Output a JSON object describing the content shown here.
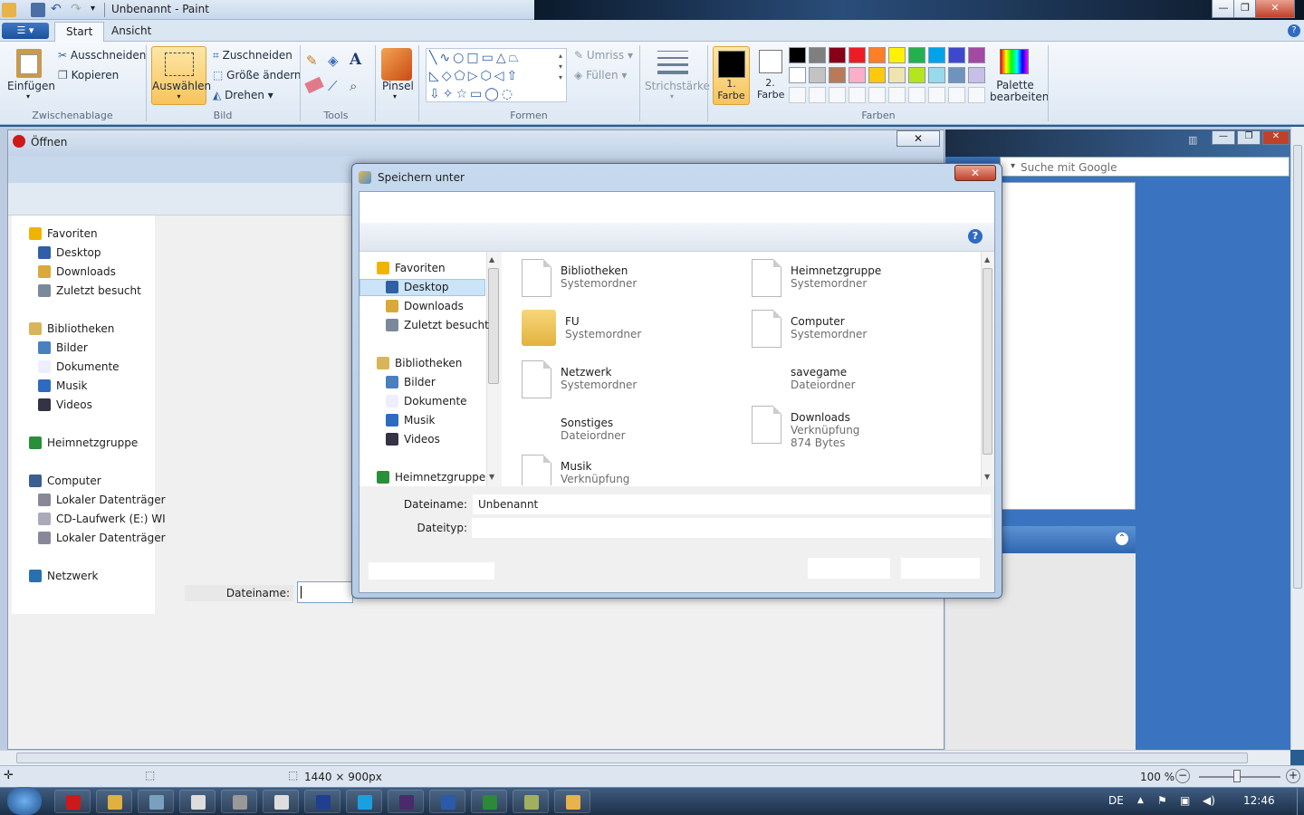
{
  "window": {
    "title": "Unbenannt - Paint"
  },
  "tabs": {
    "menu": "☰ ▾",
    "start": "Start",
    "view": "Ansicht"
  },
  "clipboard": {
    "paste": "Einfügen",
    "cut": "Ausschneiden",
    "copy": "Kopieren",
    "label": "Zwischenablage"
  },
  "image": {
    "select": "Auswählen",
    "crop": "Zuschneiden",
    "resize": "Größe ändern",
    "rotate": "Drehen",
    "label": "Bild"
  },
  "tools": {
    "label": "Tools"
  },
  "brush": {
    "label": "Pinsel"
  },
  "shapes": {
    "outline": "Umriss",
    "fill": "Füllen",
    "label": "Formen"
  },
  "stroke": {
    "label": "Strichstärke"
  },
  "colors": {
    "color1": "1. Farbe",
    "color2": "2. Farbe",
    "edit": "Palette bearbeiten",
    "label": "Farben",
    "palette": [
      "#000000",
      "#7f7f7f",
      "#880015",
      "#ed1c24",
      "#ff7f27",
      "#fff200",
      "#22b14c",
      "#00a2e8",
      "#3f48cc",
      "#a349a4",
      "#ffffff",
      "#c3c3c3",
      "#b97a57",
      "#ffaec9",
      "#ffc90e",
      "#efe4b0",
      "#b5e61d",
      "#99d9ea",
      "#7092be",
      "#c8bfe7"
    ]
  },
  "bg_dialog": {
    "title": "Öffnen",
    "filename_label": "Dateiname:",
    "nav": [
      "Favoriten",
      "Desktop",
      "Downloads",
      "Zuletzt besucht",
      "Bibliotheken",
      "Bilder",
      "Dokumente",
      "Musik",
      "Videos",
      "Heimnetzgruppe",
      "Computer",
      "Lokaler Datenträger",
      "CD-Laufwerk (E:) WI",
      "Lokaler Datenträger",
      "Netzwerk"
    ]
  },
  "browser": {
    "search_placeholder": "Suche mit Google"
  },
  "save_dialog": {
    "title": "Speichern unter",
    "nav": [
      "Favoriten",
      "Desktop",
      "Downloads",
      "Zuletzt besucht",
      "Bibliotheken",
      "Bilder",
      "Dokumente",
      "Musik",
      "Videos",
      "Heimnetzgruppe"
    ],
    "files": [
      {
        "name": "Bibliotheken",
        "sub": "Systemordner"
      },
      {
        "name": "Heimnetzgruppe",
        "sub": "Systemordner"
      },
      {
        "name": "FU",
        "sub": "Systemordner"
      },
      {
        "name": "Computer",
        "sub": "Systemordner"
      },
      {
        "name": "Netzwerk",
        "sub": "Systemordner"
      },
      {
        "name": "savegame",
        "sub": "Dateiordner"
      },
      {
        "name": "Sonstiges",
        "sub": "Dateiordner"
      },
      {
        "name": "Downloads",
        "sub": "Verknüpfung",
        "size": "874 Bytes"
      },
      {
        "name": "Musik",
        "sub": "Verknüpfung"
      }
    ],
    "filename_label": "Dateiname:",
    "filename_value": "Unbenannt",
    "filetype_label": "Dateityp:"
  },
  "status": {
    "dimensions": "1440 × 900px",
    "zoom": "100 %"
  },
  "taskbar": {
    "lang": "DE",
    "time": "12:46"
  }
}
